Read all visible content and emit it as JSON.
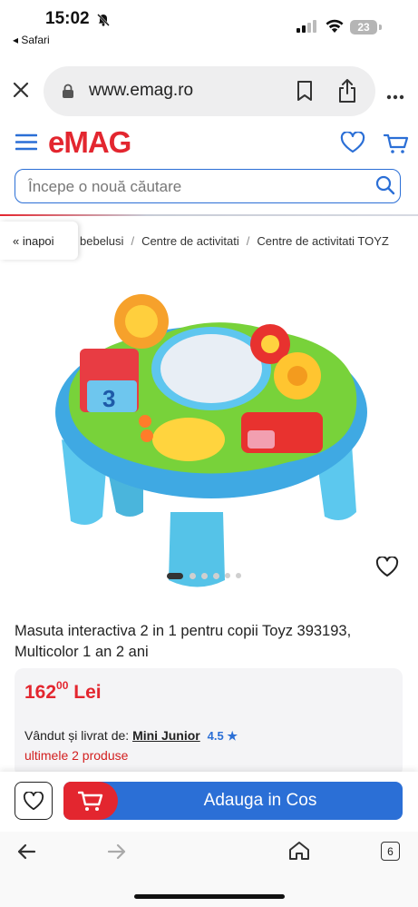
{
  "status_bar": {
    "time": "15:02",
    "back_app": "◂ Safari",
    "battery": "23"
  },
  "url_bar": {
    "url": "www.emag.ro"
  },
  "header": {
    "logo": "eMAG",
    "search_placeholder": "Începe o nouă căutare"
  },
  "breadcrumb": {
    "back": "« inapoi",
    "items": [
      "bebelusi",
      "Centre de activitati",
      "Centre de activitati TOYZ"
    ]
  },
  "product": {
    "title": "Masuta interactiva 2 in 1 pentru copii Toyz 393193, Multicolor 1 an 2 ani",
    "price_int": "162",
    "price_dec": "00",
    "currency": "Lei",
    "sold_by_label": "Vândut și livrat de:",
    "seller": "Mini Junior",
    "rating": "4.5",
    "stock": "ultimele 2 produse",
    "images_count": 6,
    "active_image": 1
  },
  "actions": {
    "add_to_cart": "Adauga in Cos"
  },
  "toolbar": {
    "tabs_count": "6"
  },
  "colors": {
    "brand_red": "#e3262f",
    "brand_blue": "#2b6fd6"
  }
}
